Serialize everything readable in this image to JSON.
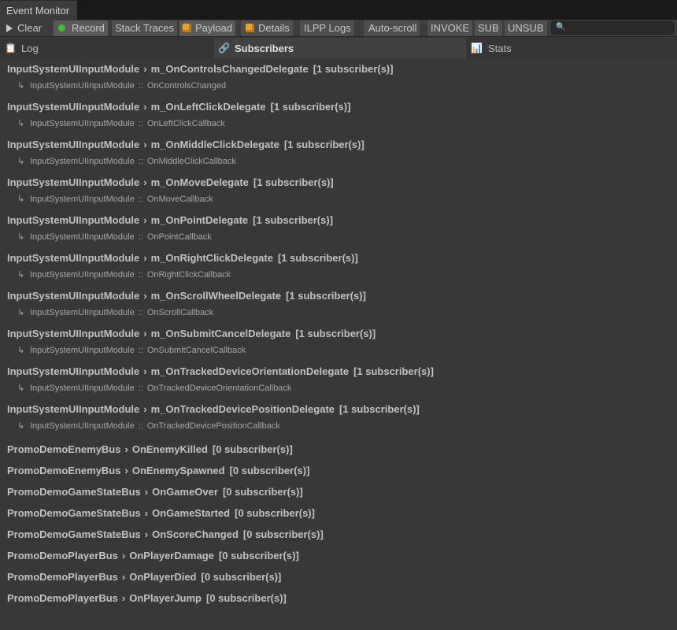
{
  "window": {
    "title": "Event Monitor"
  },
  "toolbar": {
    "clear_label": "Clear",
    "record_label": "Record",
    "stack_traces_label": "Stack Traces",
    "payload_label": "Payload",
    "details_label": "Details",
    "ilpp_logs_label": "ILPP Logs",
    "auto_scroll_label": "Auto-scroll",
    "invoke_label": "INVOKE",
    "sub_label": "SUB",
    "unsub_label": "UNSUB",
    "search": {
      "value": "",
      "placeholder": ""
    },
    "colors": {
      "record_dot": "#3dbf2e",
      "box_icon": "#e2a33a"
    }
  },
  "tabs": {
    "log": {
      "label": "Log",
      "icon": "clipboard-icon"
    },
    "subscribers": {
      "label": "Subscribers",
      "icon": "link-icon"
    },
    "stats": {
      "label": "Stats",
      "icon": "bar-chart-icon"
    }
  },
  "entries": [
    {
      "owner": "InputSystemUIInputModule",
      "event": "m_OnControlsChangedDelegate",
      "count": "[1 subscriber(s)]",
      "sub_owner": "InputSystemUIInputModule",
      "sub_method": "OnControlsChanged"
    },
    {
      "owner": "InputSystemUIInputModule",
      "event": "m_OnLeftClickDelegate",
      "count": "[1 subscriber(s)]",
      "sub_owner": "InputSystemUIInputModule",
      "sub_method": "OnLeftClickCallback"
    },
    {
      "owner": "InputSystemUIInputModule",
      "event": "m_OnMiddleClickDelegate",
      "count": "[1 subscriber(s)]",
      "sub_owner": "InputSystemUIInputModule",
      "sub_method": "OnMiddleClickCallback"
    },
    {
      "owner": "InputSystemUIInputModule",
      "event": "m_OnMoveDelegate",
      "count": "[1 subscriber(s)]",
      "sub_owner": "InputSystemUIInputModule",
      "sub_method": "OnMoveCallback"
    },
    {
      "owner": "InputSystemUIInputModule",
      "event": "m_OnPointDelegate",
      "count": "[1 subscriber(s)]",
      "sub_owner": "InputSystemUIInputModule",
      "sub_method": "OnPointCallback"
    },
    {
      "owner": "InputSystemUIInputModule",
      "event": "m_OnRightClickDelegate",
      "count": "[1 subscriber(s)]",
      "sub_owner": "InputSystemUIInputModule",
      "sub_method": "OnRightClickCallback"
    },
    {
      "owner": "InputSystemUIInputModule",
      "event": "m_OnScrollWheelDelegate",
      "count": "[1 subscriber(s)]",
      "sub_owner": "InputSystemUIInputModule",
      "sub_method": "OnScrollCallback"
    },
    {
      "owner": "InputSystemUIInputModule",
      "event": "m_OnSubmitCancelDelegate",
      "count": "[1 subscriber(s)]",
      "sub_owner": "InputSystemUIInputModule",
      "sub_method": "OnSubmitCancelCallback"
    },
    {
      "owner": "InputSystemUIInputModule",
      "event": "m_OnTrackedDeviceOrientationDelegate",
      "count": "[1 subscriber(s)]",
      "sub_owner": "InputSystemUIInputModule",
      "sub_method": "OnTrackedDeviceOrientationCallback"
    },
    {
      "owner": "InputSystemUIInputModule",
      "event": "m_OnTrackedDevicePositionDelegate",
      "count": "[1 subscriber(s)]",
      "sub_owner": "InputSystemUIInputModule",
      "sub_method": "OnTrackedDevicePositionCallback"
    },
    {
      "owner": "PromoDemoEnemyBus",
      "event": "OnEnemyKilled",
      "count": "[0 subscriber(s)]"
    },
    {
      "owner": "PromoDemoEnemyBus",
      "event": "OnEnemySpawned",
      "count": "[0 subscriber(s)]"
    },
    {
      "owner": "PromoDemoGameStateBus",
      "event": "OnGameOver",
      "count": "[0 subscriber(s)]"
    },
    {
      "owner": "PromoDemoGameStateBus",
      "event": "OnGameStarted",
      "count": "[0 subscriber(s)]"
    },
    {
      "owner": "PromoDemoGameStateBus",
      "event": "OnScoreChanged",
      "count": "[0 subscriber(s)]"
    },
    {
      "owner": "PromoDemoPlayerBus",
      "event": "OnPlayerDamage",
      "count": "[0 subscriber(s)]"
    },
    {
      "owner": "PromoDemoPlayerBus",
      "event": "OnPlayerDied",
      "count": "[0 subscriber(s)]"
    },
    {
      "owner": "PromoDemoPlayerBus",
      "event": "OnPlayerJump",
      "count": "[0 subscriber(s)]"
    }
  ],
  "glyphs": {
    "chevron": "›",
    "sub_arrow": "↳",
    "double_colon": "::"
  }
}
